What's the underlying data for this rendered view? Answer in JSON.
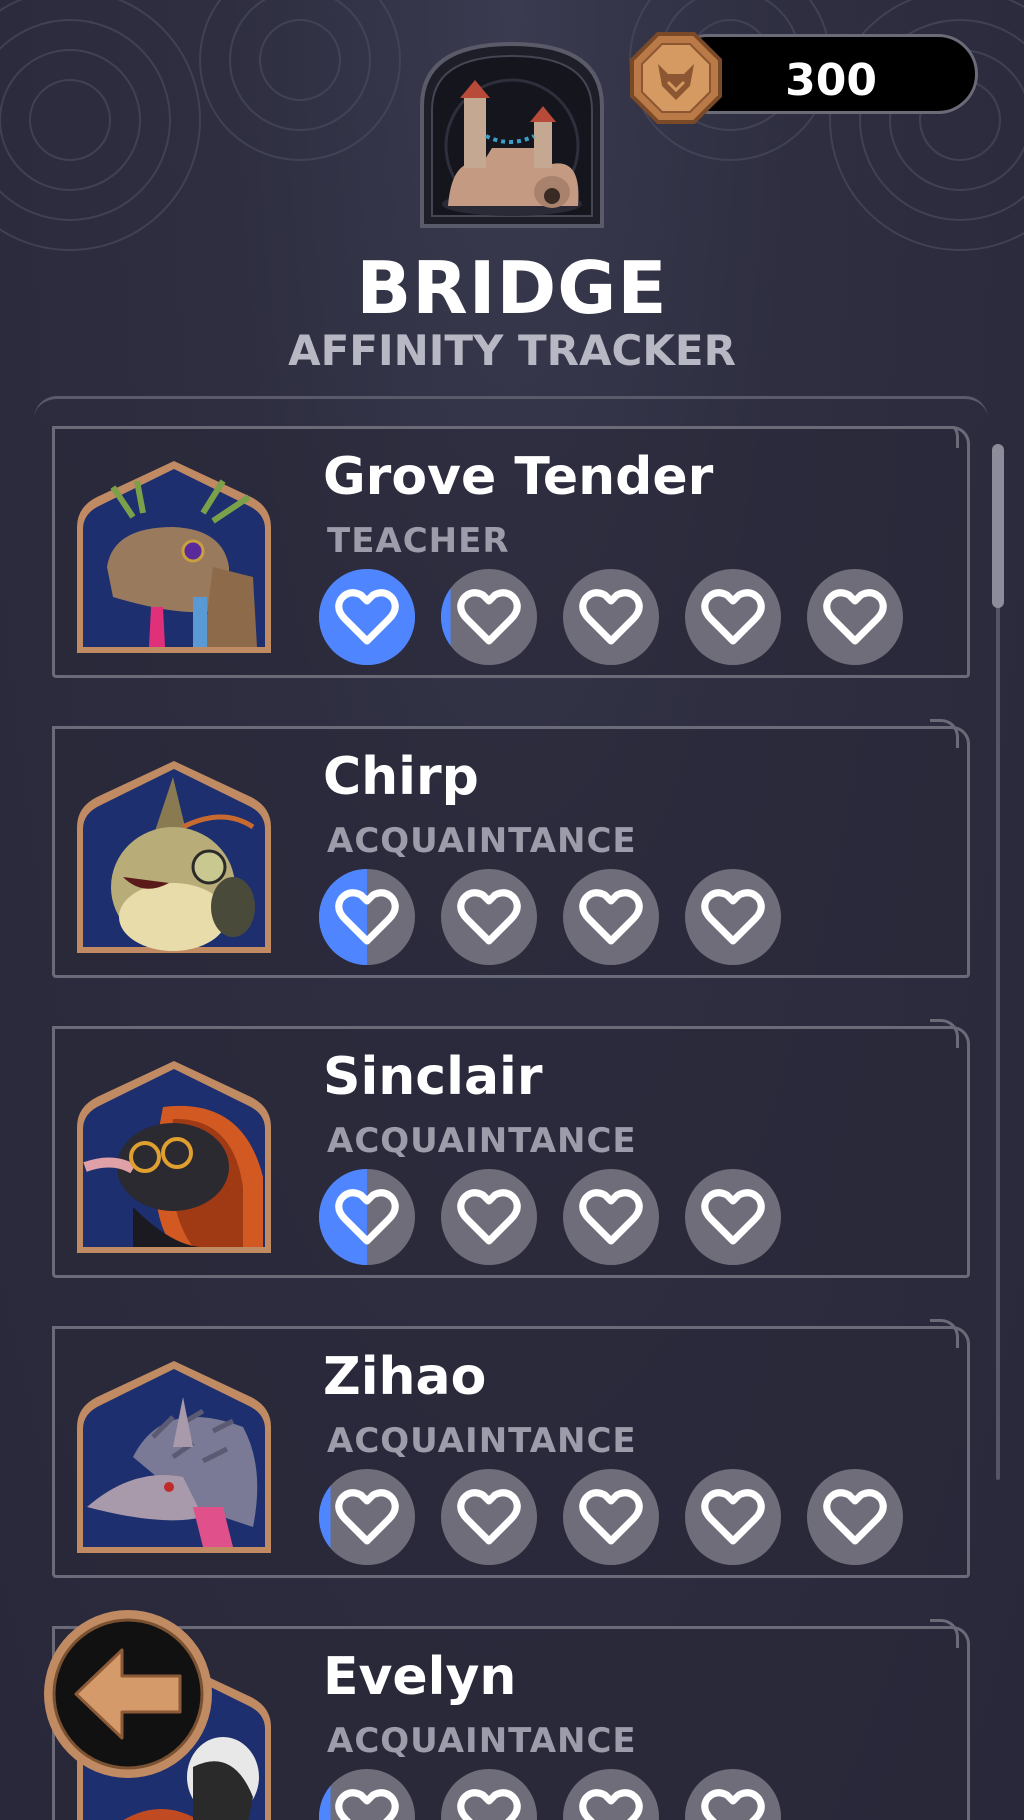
{
  "currency": {
    "amount": "300",
    "icon": "fox-coin-icon"
  },
  "location": {
    "name": "BRIDGE",
    "subtitle": "AFFINITY TRACKER",
    "icon": "castle-bridge-icon"
  },
  "colors": {
    "accent": "#4f86ff",
    "heart_empty": "#6e6d79",
    "frame": "#c08a62"
  },
  "npcs": [
    {
      "name": "Grove Tender",
      "role": "TEACHER",
      "hearts": 5,
      "fills": [
        1,
        0.1,
        0,
        0,
        0
      ],
      "portrait": "grove-tender-portrait"
    },
    {
      "name": "Chirp",
      "role": "ACQUAINTANCE",
      "hearts": 4,
      "fills": [
        0.5,
        0,
        0,
        0
      ],
      "portrait": "chirp-portrait"
    },
    {
      "name": "Sinclair",
      "role": "ACQUAINTANCE",
      "hearts": 4,
      "fills": [
        0.5,
        0,
        0,
        0
      ],
      "portrait": "sinclair-portrait"
    },
    {
      "name": "Zihao",
      "role": "ACQUAINTANCE",
      "hearts": 5,
      "fills": [
        0.12,
        0,
        0,
        0,
        0
      ],
      "portrait": "zihao-portrait"
    },
    {
      "name": "Evelyn",
      "role": "ACQUAINTANCE",
      "hearts": 4,
      "fills": [
        0.12,
        0,
        0,
        0
      ],
      "portrait": "evelyn-portrait"
    }
  ],
  "back": {
    "icon": "back-arrow-icon"
  }
}
